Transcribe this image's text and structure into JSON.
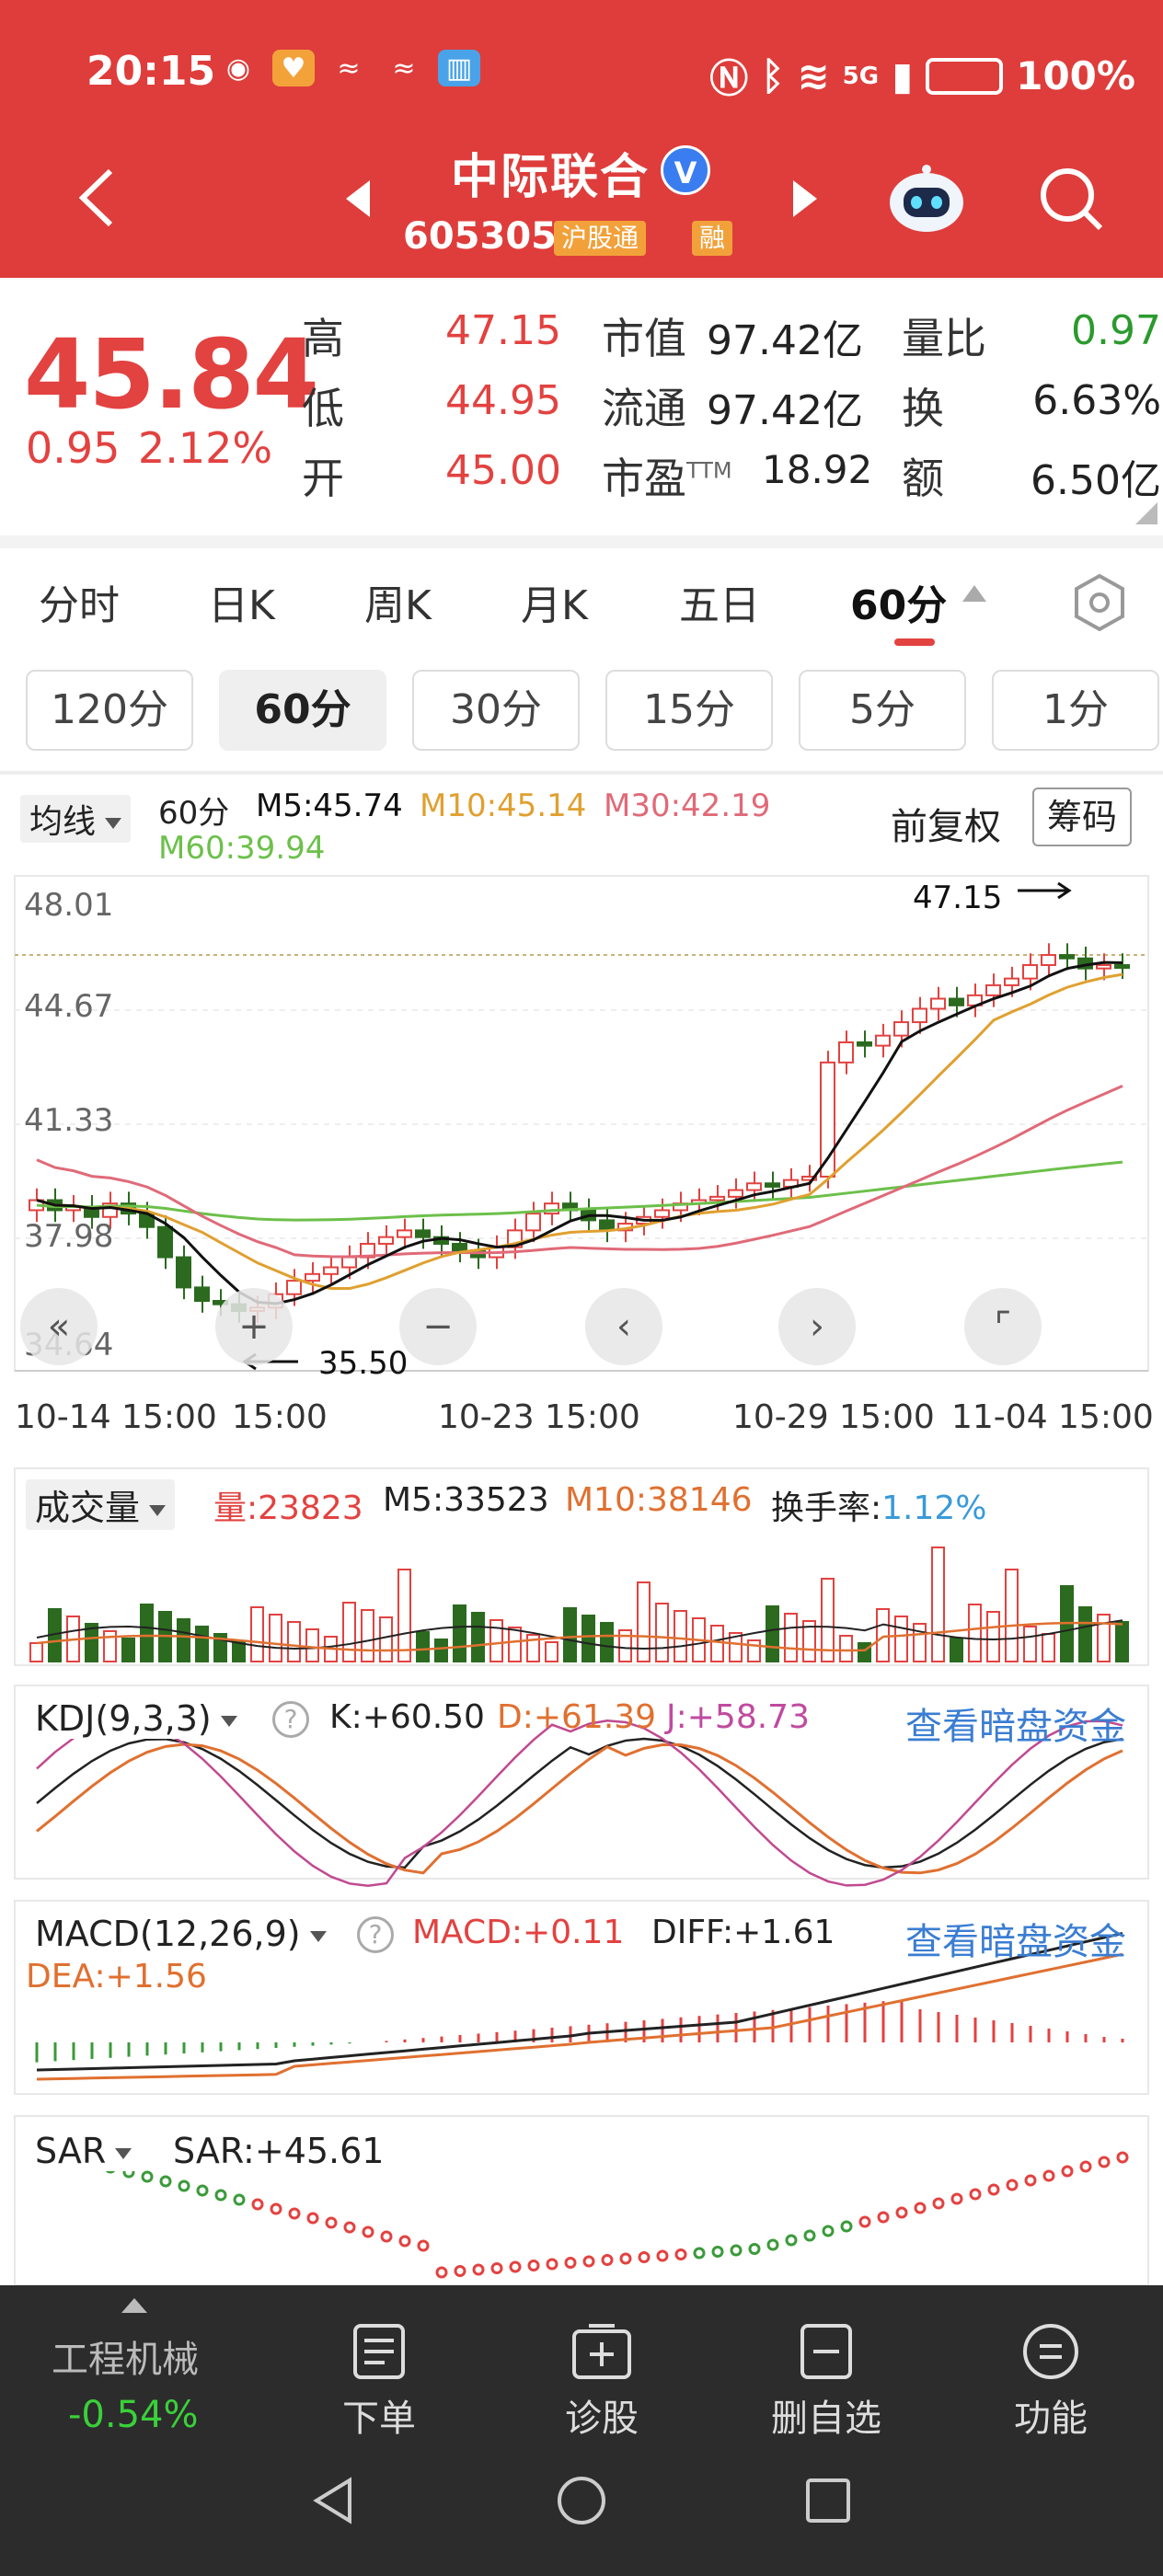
{
  "status_bar": {
    "time": "20:15",
    "network": "5G",
    "battery": "100%"
  },
  "header": {
    "stock_name": "中际联合",
    "verified_mark": "V",
    "stock_code": "605305",
    "tags": [
      "沪股通",
      "融"
    ]
  },
  "quote": {
    "price": "45.84",
    "change": "0.95",
    "change_pct": "2.12%",
    "high_label": "高",
    "high": "47.15",
    "low_label": "低",
    "low": "44.95",
    "open_label": "开",
    "open": "45.00",
    "mktcap_label": "市值",
    "mktcap": "97.42亿",
    "float_label": "流通",
    "float": "97.42亿",
    "pe_label": "市盈",
    "pe_sup": "TTM",
    "pe": "18.92",
    "vol_ratio_label": "量比",
    "vol_ratio": "0.97",
    "turnover_label": "换",
    "turnover": "6.63%",
    "amount_label": "额",
    "amount": "6.50亿"
  },
  "period_tabs": [
    "分时",
    "日K",
    "周K",
    "月K",
    "五日",
    "60分"
  ],
  "active_period": "60分",
  "sub_periods": [
    "120分",
    "60分",
    "30分",
    "15分",
    "5分",
    "1分"
  ],
  "ma": {
    "selector": "均线",
    "period": "60分",
    "m5": "M5:45.74",
    "m10": "M10:45.14",
    "m30": "M30:42.19",
    "m60": "M60:39.94"
  },
  "adjust_buttons": {
    "fq": "前复权",
    "chip": "筹码"
  },
  "kline": {
    "price_ticks": [
      "48.01",
      "44.67",
      "41.33",
      "37.98",
      "34.64"
    ],
    "high_annotation": "47.15",
    "low_annotation": "35.50",
    "dates": [
      "10-14 15:00",
      "15:00",
      "10-23 15:00",
      "10-29 15:00",
      "11-04 15:00"
    ]
  },
  "volume": {
    "selector": "成交量",
    "vol": "量:23823",
    "m5": "M5:33523",
    "m10": "M10:38146",
    "turnover_label": "换手率:",
    "turnover": "1.12%"
  },
  "kdj": {
    "selector": "KDJ(9,3,3)",
    "k": "K:+60.50",
    "d": "D:+61.39",
    "j": "J:+58.73",
    "link": "查看暗盘资金"
  },
  "macd": {
    "selector": "MACD(12,26,9)",
    "macd": "MACD:+0.11",
    "diff": "DIFF:+1.61",
    "dea": "DEA:+1.56",
    "link": "查看暗盘资金"
  },
  "sar": {
    "selector": "SAR",
    "value": "SAR:+45.61"
  },
  "bottom": {
    "sector_name": "工程机械",
    "sector_change": "-0.54%",
    "order": "下单",
    "diagnose": "诊股",
    "remove_watch": "删自选",
    "functions": "功能"
  },
  "colors": {
    "brand_red": "#de3d3b",
    "up": "#e24240",
    "down": "#2b6a1f",
    "ma5": "#111111",
    "ma10": "#e0a030",
    "ma30": "#e06a78",
    "ma60": "#6cc04a"
  }
}
